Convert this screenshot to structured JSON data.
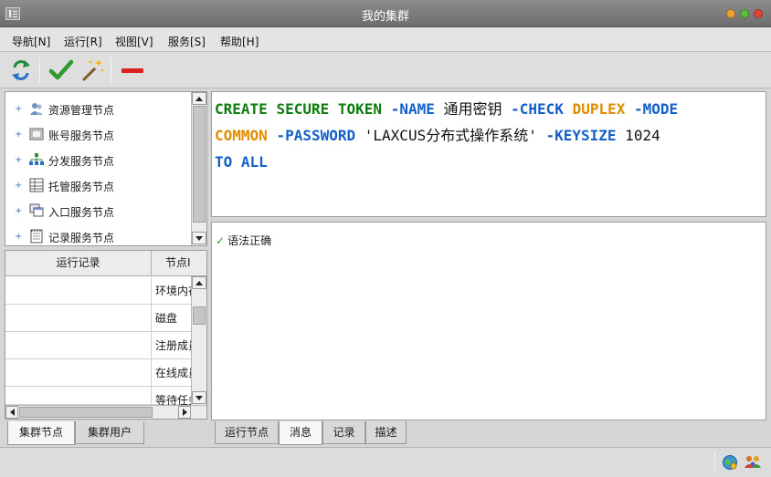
{
  "window": {
    "title": "我的集群"
  },
  "menu": [
    "导航[N]",
    "运行[R]",
    "视图[V]",
    "服务[S]",
    "帮助[H]"
  ],
  "toolbar": {
    "icons": [
      "refresh-icon",
      "check-icon",
      "magic-wand-icon",
      "stop-icon"
    ],
    "colors": {
      "check": "#2e9a2e",
      "stop": "#d92020",
      "refresh": "#1f8e3a"
    }
  },
  "tree": {
    "expander": "+",
    "items": [
      {
        "label": "资源管理节点",
        "icon": "users-icon"
      },
      {
        "label": "账号服务节点",
        "icon": "account-icon"
      },
      {
        "label": "分发服务节点",
        "icon": "hierarchy-icon"
      },
      {
        "label": "托管服务节点",
        "icon": "table-icon"
      },
      {
        "label": "入口服务节点",
        "icon": "window-stack-icon"
      },
      {
        "label": "记录服务节点",
        "icon": "notepad-icon"
      }
    ]
  },
  "log_table": {
    "columns": [
      "运行记录",
      "节点I"
    ],
    "rows": [
      [
        "",
        "环境内存"
      ],
      [
        "",
        "磁盘"
      ],
      [
        "",
        "注册成员"
      ],
      [
        "",
        "在线成员"
      ],
      [
        "",
        "等待任务"
      ]
    ]
  },
  "left_tabs": [
    "集群节点",
    "集群用户"
  ],
  "editor": {
    "colors": {
      "green": "#0d7d0d",
      "blue": "#1460c8",
      "orange": "#e08c00",
      "black": "#111111"
    },
    "lines": [
      [
        {
          "text": "CREATE",
          "color": "green"
        },
        {
          "text": " ",
          "color": "black"
        },
        {
          "text": "SECURE",
          "color": "green"
        },
        {
          "text": " ",
          "color": "black"
        },
        {
          "text": "TOKEN",
          "color": "green"
        },
        {
          "text": " ",
          "color": "black"
        },
        {
          "text": "-NAME",
          "color": "blue"
        },
        {
          "text": " 通用密钥 ",
          "color": "black"
        },
        {
          "text": "-CHECK",
          "color": "blue"
        },
        {
          "text": " ",
          "color": "black"
        },
        {
          "text": "DUPLEX",
          "color": "orange"
        },
        {
          "text": " ",
          "color": "black"
        },
        {
          "text": "-MODE",
          "color": "blue"
        }
      ],
      [
        {
          "text": "COMMON",
          "color": "orange"
        },
        {
          "text": " ",
          "color": "black"
        },
        {
          "text": "-PASSWORD",
          "color": "blue"
        },
        {
          "text": " 'LAXCUS分布式操作系统' ",
          "color": "black"
        },
        {
          "text": "-KEYSIZE",
          "color": "blue"
        },
        {
          "text": " 1024",
          "color": "black"
        }
      ],
      [
        {
          "text": "TO",
          "color": "blue"
        },
        {
          "text": " ",
          "color": "black"
        },
        {
          "text": "ALL",
          "color": "blue"
        }
      ]
    ]
  },
  "message": {
    "text": "语法正确"
  },
  "bottom_tabs": [
    "运行节点",
    "消息",
    "记录",
    "描述"
  ],
  "status": {
    "icons": [
      "network-globe-icon",
      "users-group-icon"
    ]
  }
}
